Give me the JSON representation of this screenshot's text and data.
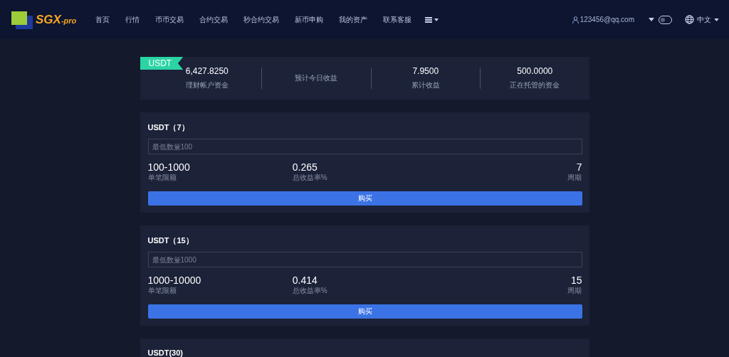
{
  "brand": {
    "name": "SGX",
    "suffix": "-pro"
  },
  "nav": [
    {
      "label": "首页",
      "selected": false
    },
    {
      "label": "行情",
      "selected": false
    },
    {
      "label": "币币交易",
      "selected": false
    },
    {
      "label": "合约交易",
      "selected": false
    },
    {
      "label": "秒合约交易",
      "selected": false
    },
    {
      "label": "新币申购",
      "selected": false
    },
    {
      "label": "我的资产",
      "selected": false
    },
    {
      "label": "联系客服",
      "selected": false
    }
  ],
  "user": {
    "email": "123456@qq.com"
  },
  "theme_toggle": {
    "on": false
  },
  "language": "中文",
  "summary": {
    "tag": "USDT",
    "items": [
      {
        "value": "6,427.8250",
        "label": "理财帐户资金"
      },
      {
        "label": "预计今日收益"
      },
      {
        "value": "7.9500",
        "label": "累计收益"
      },
      {
        "value": "500.0000",
        "label": "正在托管的资金"
      }
    ]
  },
  "products": [
    {
      "title": "USDT（7）",
      "placeholder": "最低数量100",
      "range": "100-1000",
      "range_label": "单笔限额",
      "rate": "0.265",
      "rate_label": "总收益率%",
      "period": "7",
      "period_label": "周期",
      "button": "购买"
    },
    {
      "title": "USDT（15）",
      "placeholder": "最低数量1000",
      "range": "1000-10000",
      "range_label": "单笔限额",
      "rate": "0.414",
      "rate_label": "总收益率%",
      "period": "15",
      "period_label": "周期",
      "button": "购买"
    },
    {
      "title": "USDT(30)"
    }
  ]
}
